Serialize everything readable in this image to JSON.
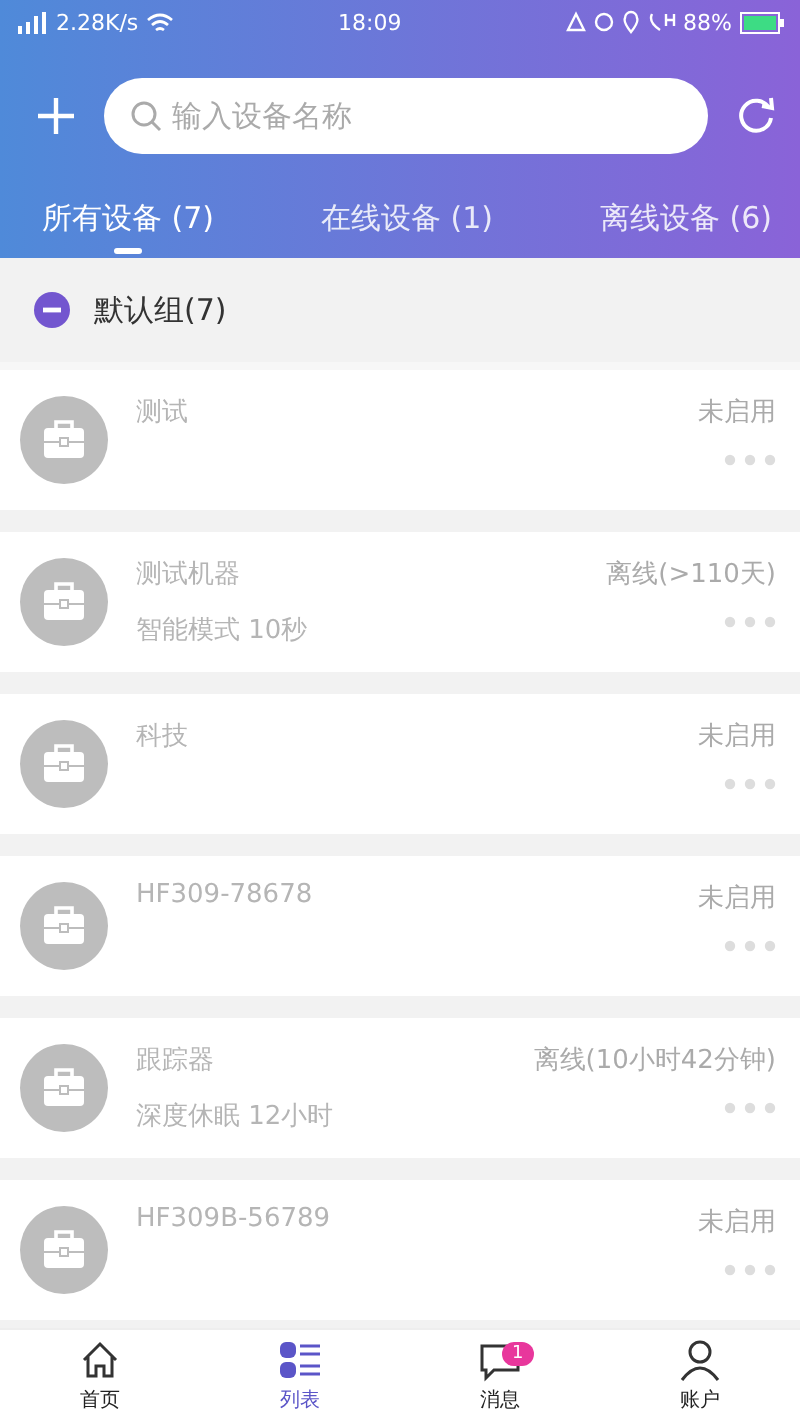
{
  "status_bar": {
    "speed": "2.28K/s",
    "time": "18:09",
    "battery": "88%"
  },
  "search": {
    "placeholder": "输入设备名称"
  },
  "tabs": [
    {
      "label": "所有设备 (7)",
      "selected": true
    },
    {
      "label": "在线设备 (1)",
      "selected": false
    },
    {
      "label": "离线设备 (6)",
      "selected": false
    }
  ],
  "group": {
    "title": "默认组(7)",
    "expanded": true
  },
  "devices": [
    {
      "name": "测试",
      "status": "未启用"
    },
    {
      "name": "测试机器",
      "detail": "智能模式 10秒",
      "status": "离线(>110天)"
    },
    {
      "name": "科技",
      "status": "未启用"
    },
    {
      "name": "HF309-78678",
      "status": "未启用"
    },
    {
      "name": "跟踪器",
      "detail": "深度休眠 12小时",
      "status": "离线(10小时42分钟)"
    },
    {
      "name": "HF309B-56789",
      "status": "未启用"
    }
  ],
  "nav": [
    {
      "label": "首页",
      "kind": "home",
      "selected": false
    },
    {
      "label": "列表",
      "kind": "list",
      "selected": true
    },
    {
      "label": "消息",
      "kind": "message",
      "selected": false,
      "badge": "1"
    },
    {
      "label": "账户",
      "kind": "account",
      "selected": false
    }
  ]
}
